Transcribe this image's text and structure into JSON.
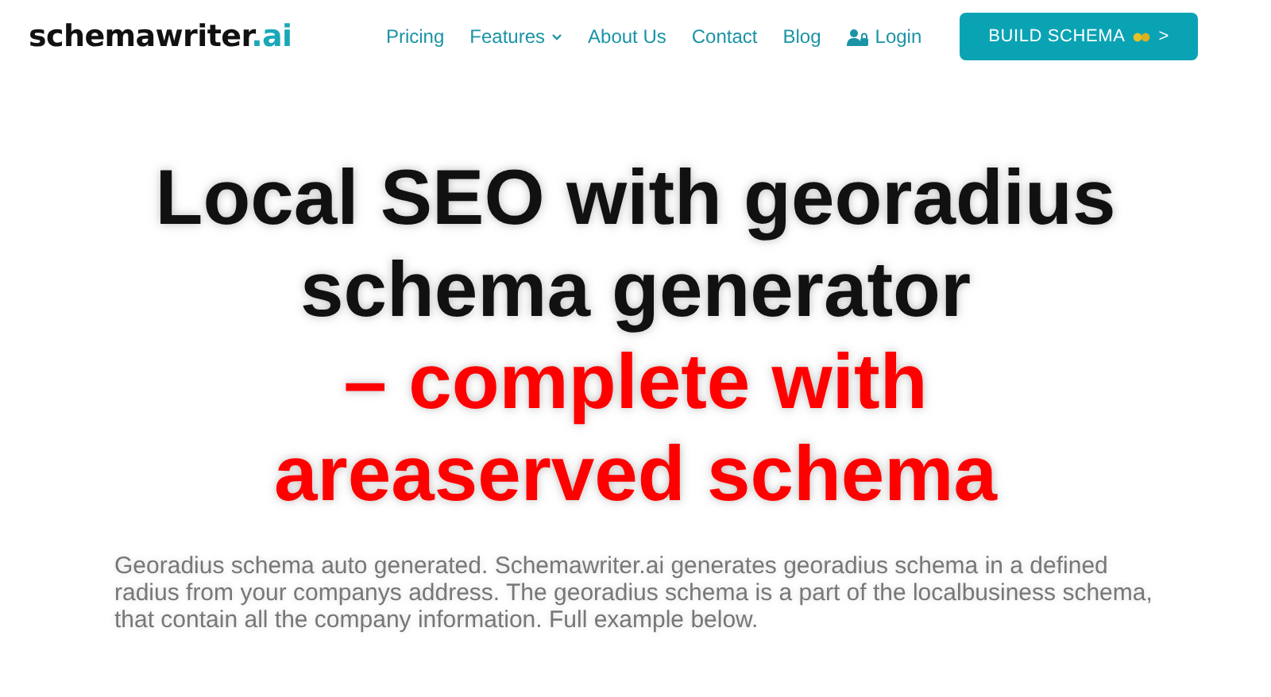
{
  "brand": {
    "name": "schemawriter",
    "suffix": ".ai"
  },
  "nav": [
    {
      "label": "Pricing",
      "kind": "link"
    },
    {
      "label": "Features",
      "kind": "dropdown"
    },
    {
      "label": "About Us",
      "kind": "link"
    },
    {
      "label": "Contact",
      "kind": "link"
    },
    {
      "label": "Blog",
      "kind": "link"
    },
    {
      "label": "Login",
      "kind": "login"
    }
  ],
  "cta": {
    "label": "BUILD SCHEMA",
    "arrow": ">"
  },
  "headline": [
    {
      "text": "Local SEO with georadius schema generator",
      "highlighted": false
    },
    {
      "text": "– complete with areaserved schema",
      "highlighted": true
    }
  ],
  "intro": "Georadius schema auto generated. Schemawriter.ai generates georadius schema in a defined radius from your companys address. The georadius schema is a part of the localbusiness schema, that contain all the company information. Full example below."
}
